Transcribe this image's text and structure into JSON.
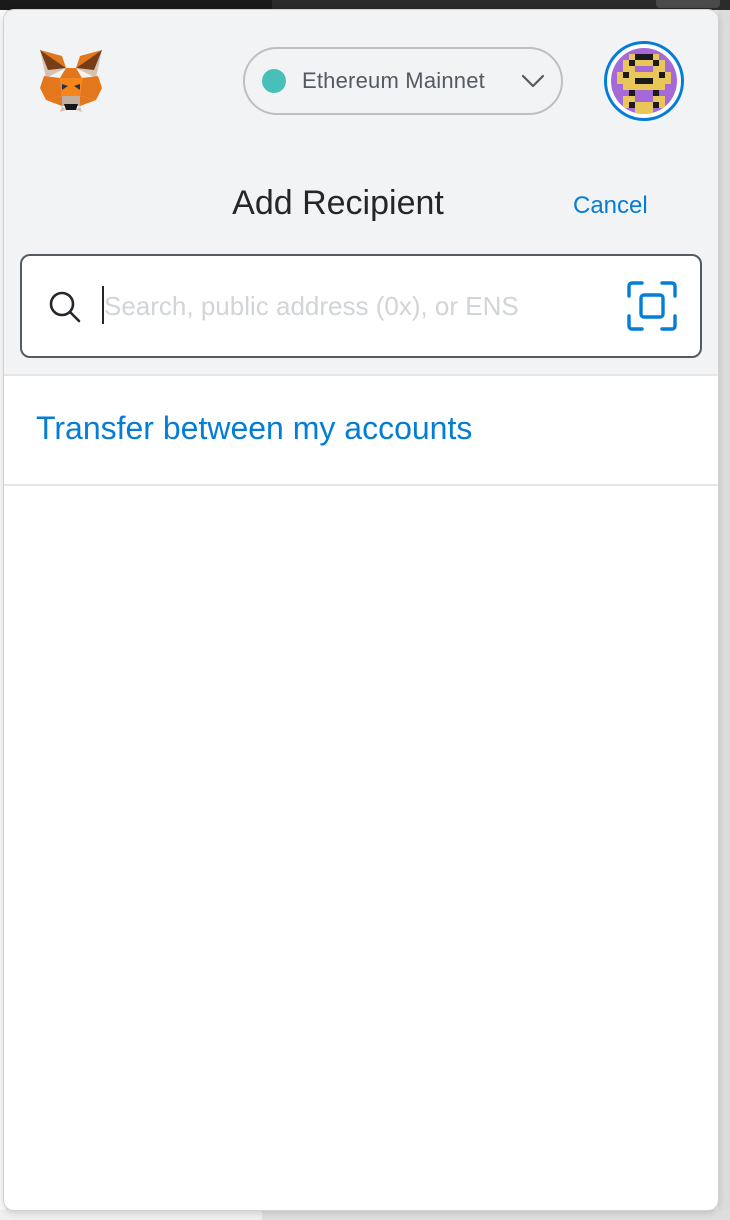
{
  "app": {
    "name": "MetaMask"
  },
  "header": {
    "logo_icon": "metamask-fox-icon",
    "network": {
      "label": "Ethereum Mainnet",
      "status_color": "#29b6af",
      "dropdown_icon": "chevron-down-icon"
    },
    "account_avatar_icon": "identicon-avatar"
  },
  "page": {
    "title": "Add Recipient",
    "cancel_label": "Cancel"
  },
  "search": {
    "value": "",
    "placeholder": "Search, public address (0x), or ENS",
    "search_icon": "search-icon",
    "scan_icon": "qr-scan-icon"
  },
  "transfer_link": "Transfer between my accounts",
  "colors": {
    "accent": "#037dd6",
    "header_bg": "#f2f3f4",
    "text_primary": "#24272a",
    "placeholder": "#d1d4d8"
  }
}
